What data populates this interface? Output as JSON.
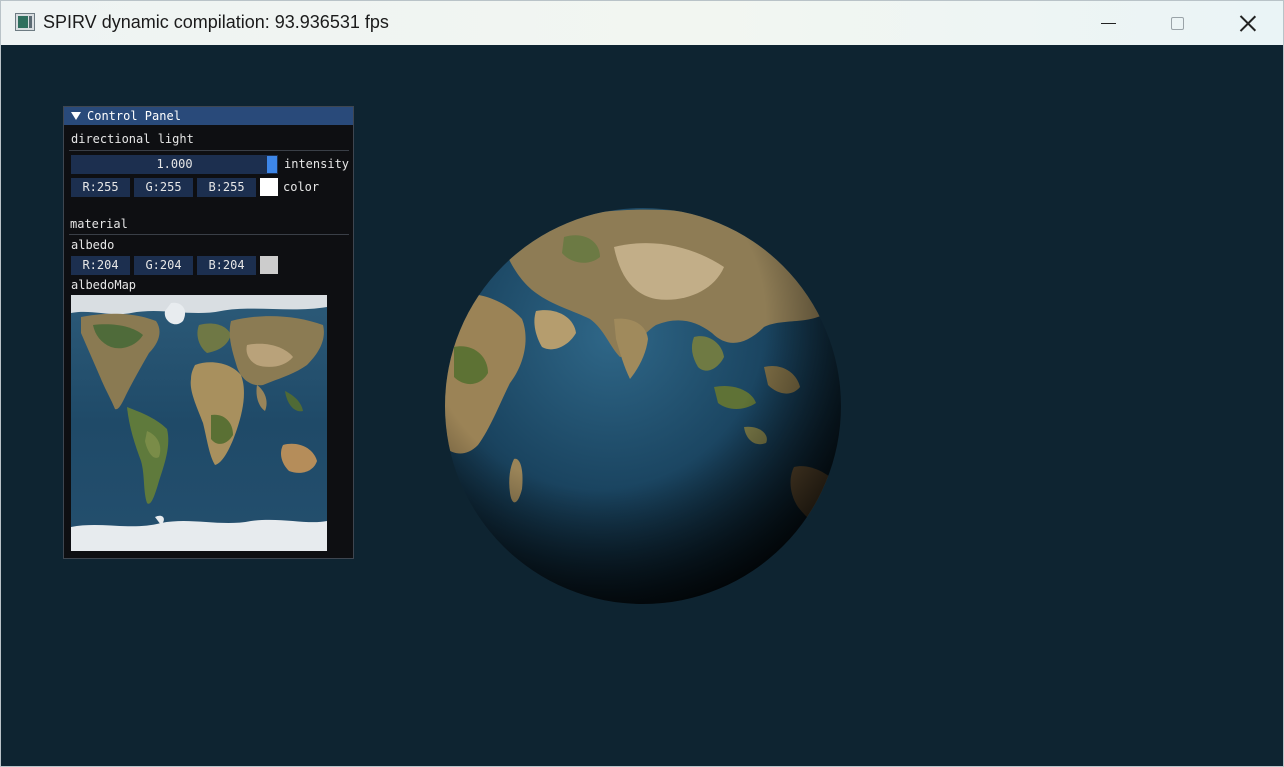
{
  "window": {
    "title": "SPIRV dynamic compilation: 93.936531 fps"
  },
  "panel": {
    "title": "Control Panel",
    "light_section": "directional light",
    "intensity_value": "1.000",
    "intensity_fraction": 1.0,
    "intensity_label": "intensity",
    "light_color": {
      "r": "R:255",
      "g": "G:255",
      "b": "B:255",
      "swatch": "#ffffff",
      "label": "color"
    },
    "material_section": "material",
    "albedo_label": "albedo",
    "albedo": {
      "r": "R:204",
      "g": "G:204",
      "b": "B:204",
      "swatch": "#cccccc"
    },
    "albedo_map_label": "albedoMap"
  },
  "colors": {
    "background": "#0e2431",
    "panel_header": "#294a7a",
    "field_bg": "#1c2f4f",
    "slider_grab": "#3d86e8"
  }
}
